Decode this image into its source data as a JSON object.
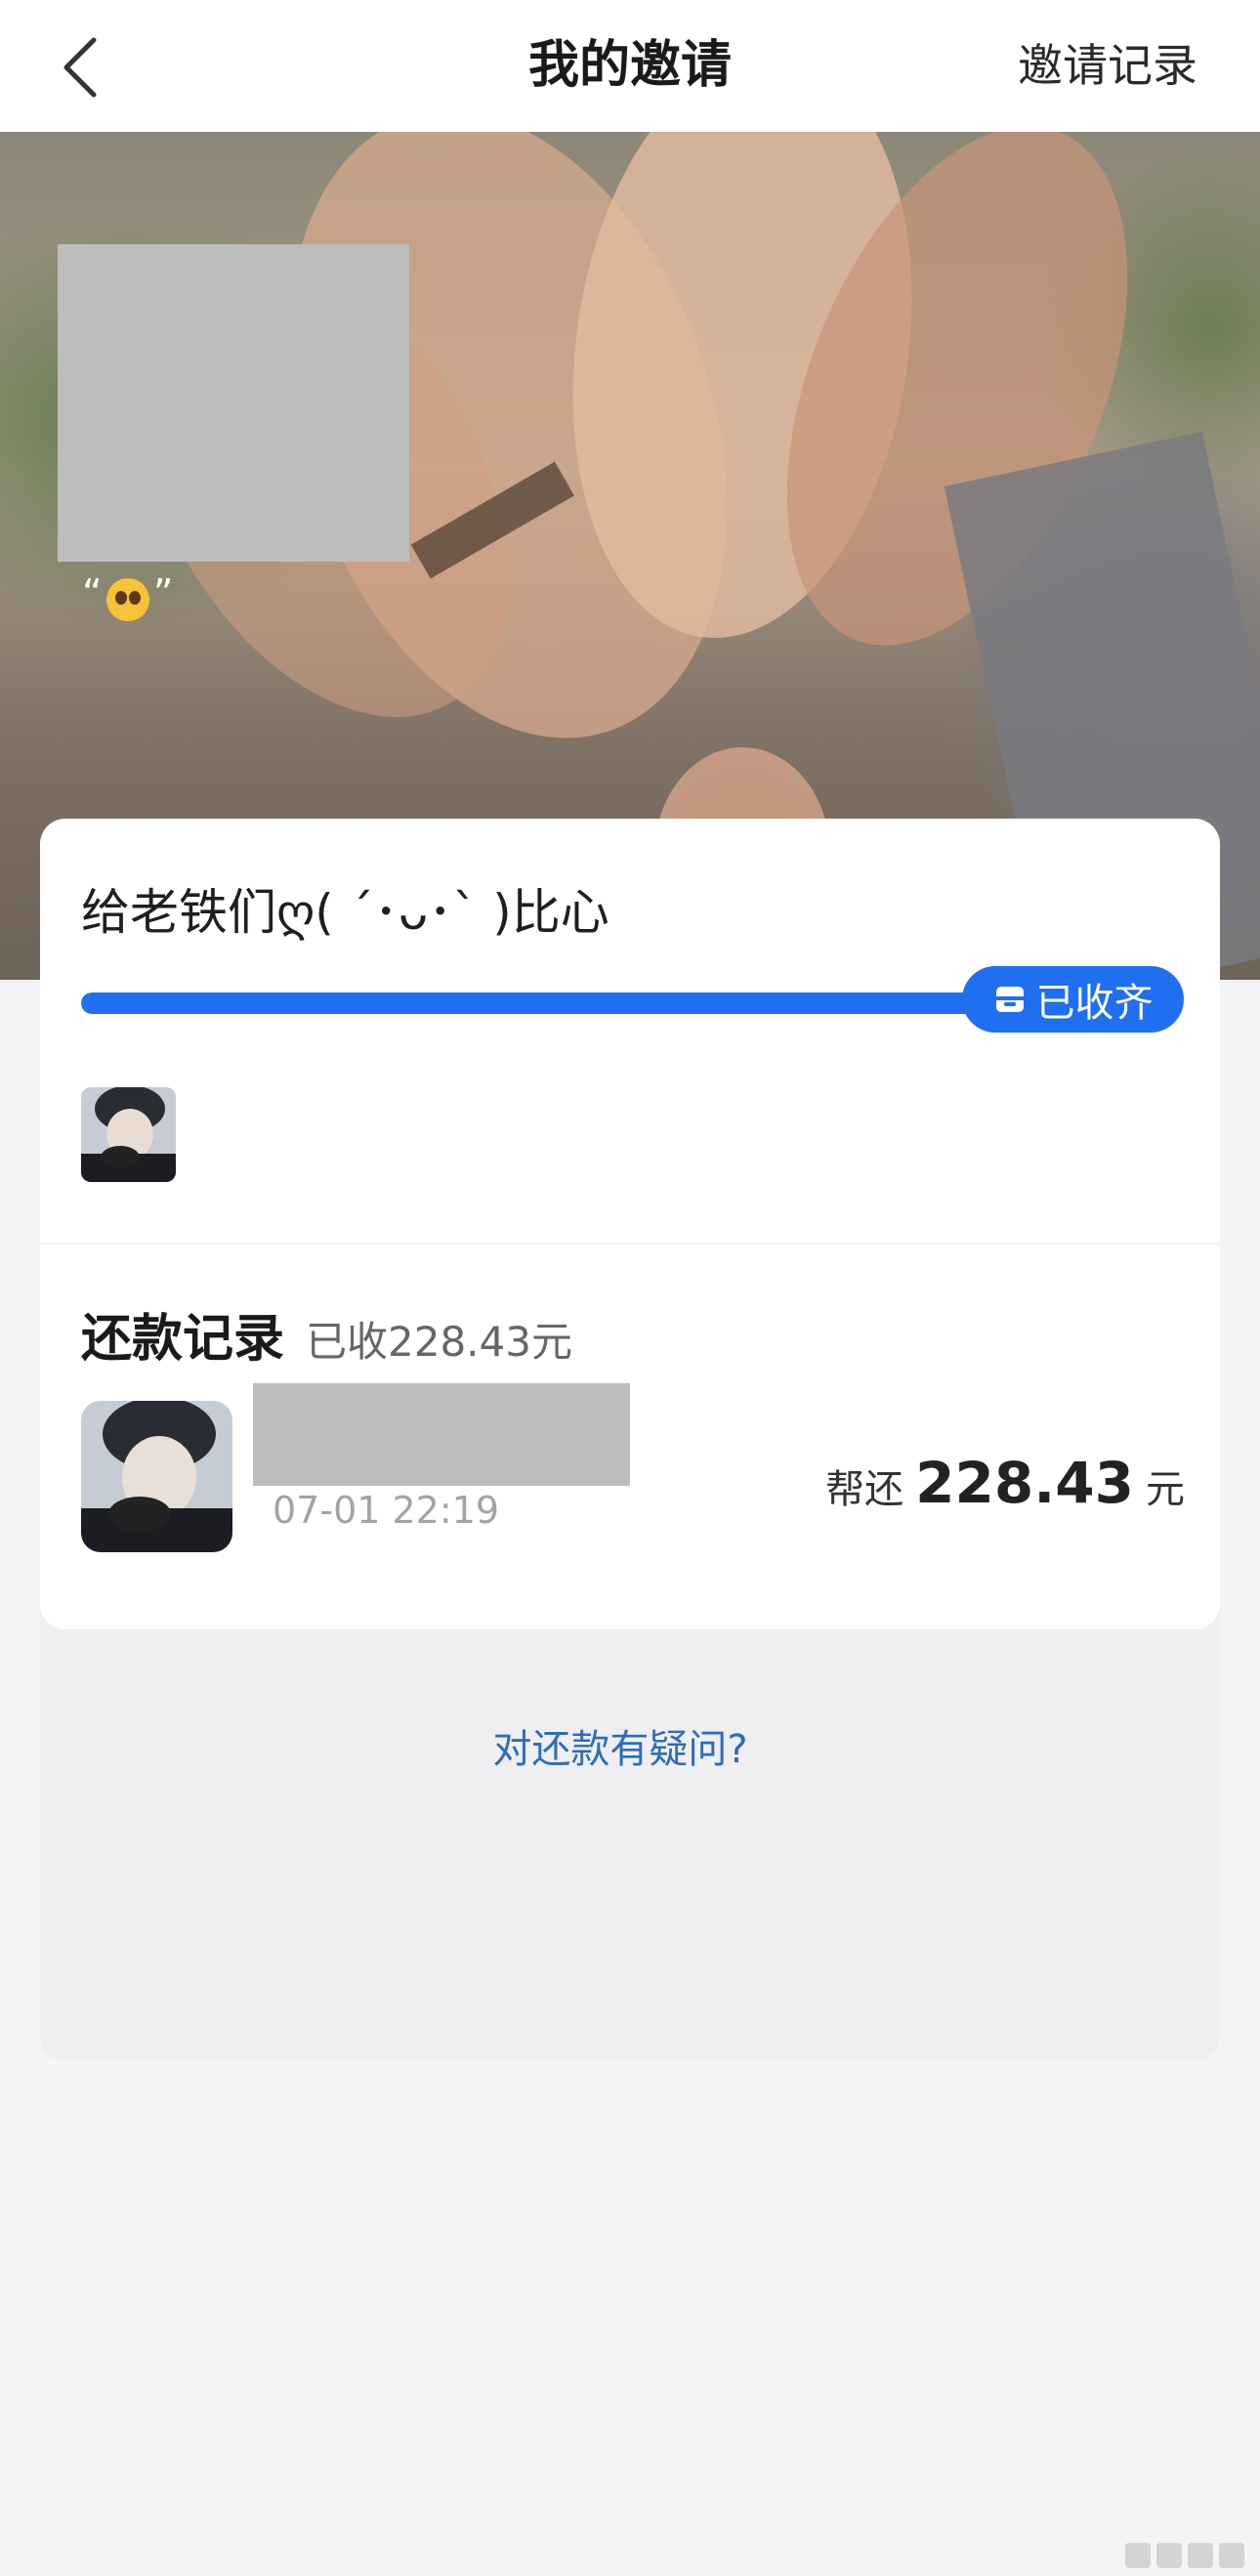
{
  "nav": {
    "title": "我的邀请",
    "right_link": "邀请记录",
    "back_icon": "chevron-left-icon"
  },
  "hero": {
    "quote": {
      "open": "“",
      "emoji": "pleading-face-emoji",
      "close": "”"
    }
  },
  "card": {
    "title": "给老铁们ღ( ´･ᴗ･` )比心",
    "progress": {
      "percent": 100,
      "status_label": "已收齐",
      "status_icon": "wallet-icon"
    },
    "records": {
      "title": "还款记录",
      "summary": "已收228.43元",
      "items": [
        {
          "time": "07-01 22:19",
          "amount_label": "帮还",
          "amount": "228.43",
          "unit": "元"
        }
      ]
    }
  },
  "help": {
    "link": "对还款有疑问?"
  },
  "colors": {
    "accent": "#1f6ff0",
    "link": "#2f6db5",
    "page_bg": "#f4f4f6",
    "card_bg": "#ffffff"
  }
}
